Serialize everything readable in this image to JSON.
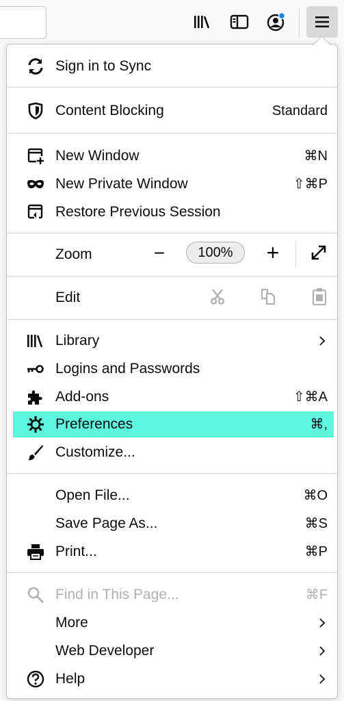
{
  "toolbar": {
    "icons": [
      "library-icon",
      "sidebar-icon",
      "account-icon",
      "hamburger-menu-icon"
    ]
  },
  "menu": {
    "sync_label": "Sign in to Sync",
    "content_blocking": {
      "label": "Content Blocking",
      "value": "Standard"
    },
    "new_window": {
      "label": "New Window",
      "shortcut": "⌘N"
    },
    "new_private_window": {
      "label": "New Private Window",
      "shortcut": "⇧⌘P"
    },
    "restore_session": {
      "label": "Restore Previous Session"
    },
    "zoom": {
      "label": "Zoom",
      "minus": "−",
      "level": "100%",
      "plus": "+"
    },
    "edit": {
      "label": "Edit"
    },
    "library": {
      "label": "Library"
    },
    "logins": {
      "label": "Logins and Passwords"
    },
    "addons": {
      "label": "Add-ons",
      "shortcut": "⇧⌘A"
    },
    "preferences": {
      "label": "Preferences",
      "shortcut": "⌘,",
      "highlight_color": "#5ff6de"
    },
    "customize": {
      "label": "Customize..."
    },
    "open_file": {
      "label": "Open File...",
      "shortcut": "⌘O"
    },
    "save_page": {
      "label": "Save Page As...",
      "shortcut": "⌘S"
    },
    "print": {
      "label": "Print...",
      "shortcut": "⌘P"
    },
    "find": {
      "label": "Find in This Page...",
      "shortcut": "⌘F"
    },
    "more": {
      "label": "More"
    },
    "web_developer": {
      "label": "Web Developer"
    },
    "help": {
      "label": "Help"
    }
  }
}
